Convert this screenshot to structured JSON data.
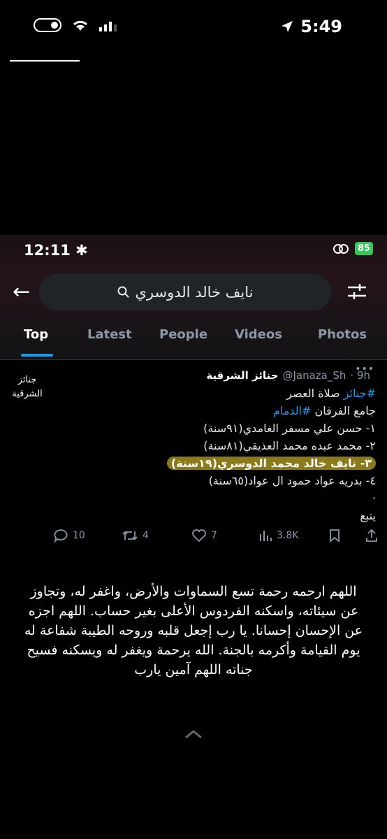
{
  "outer_status": {
    "time": "5:49"
  },
  "inner": {
    "status_time": "12:11",
    "battery": "85",
    "search_text": "نايف خالد الدوسري",
    "tabs": [
      "Top",
      "Latest",
      "People",
      "Videos",
      "Photos"
    ],
    "tweet": {
      "avatar_text": [
        "جنائز",
        "الشرقية"
      ],
      "name": "جنائز الشرقية",
      "handle": "@Janaza_Sh",
      "time": "· 9h",
      "hashtag1": "#جنائز",
      "line1_rest": " صلاة العصر",
      "line2_plain": "جامع الفرقان ",
      "hashtag2": "#الدمام",
      "items": [
        "١- حسن علي مسفر الغامدي(٩١سنة)",
        "٢- محمد عبده محمد العذيقي(٨١سنة)",
        "٣- نايف خالد محمد الدوسري(١٩سنة)",
        "٤- بدريه عواد حمود ال عواد(٦٥سنة)"
      ],
      "dot": "·",
      "follow": "يتبع",
      "replies": "10",
      "retweets": "4",
      "likes": "7",
      "views": "3.8K"
    }
  },
  "caption": "اللهم ارحمه رحمة تسع السماوات والأرض، واغفر له، وتجاوز عن سيئاته، واسكنه الفردوس الأعلى بغير حساب. اللهم اجزه عن الإحسان إحسانا. يا رب إجعل قلبه وروحه الطيبة شفاعة له يوم القيامة وأكرمه بالجنة. الله يرحمة ويغفر له ويسكنه فسيح جناته اللهم آمين يارب"
}
